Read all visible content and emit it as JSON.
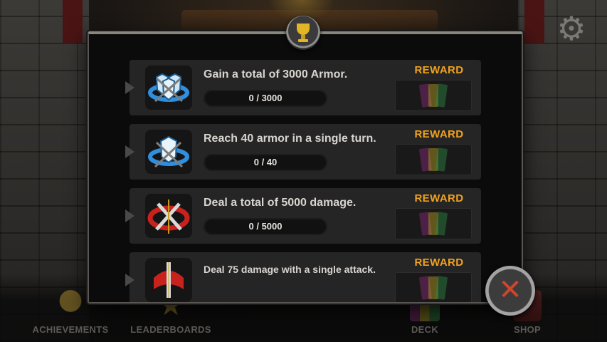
{
  "header": {
    "trophy_icon": "trophy-icon",
    "settings_icon": "gear-icon"
  },
  "achievements": [
    {
      "title": "Gain a total of 3000 Armor.",
      "progress_text": "0 / 3000",
      "progress_fraction": 0,
      "reward_label": "REWARD",
      "icon": "armor-shields-icon",
      "theme": "blue"
    },
    {
      "title": "Reach 40 armor in a single turn.",
      "progress_text": "0 / 40",
      "progress_fraction": 0,
      "reward_label": "REWARD",
      "icon": "armor-shield-icon",
      "theme": "blue"
    },
    {
      "title": "Deal a total of 5000 damage.",
      "progress_text": "0 / 5000",
      "progress_fraction": 0,
      "reward_label": "REWARD",
      "icon": "crossed-swords-icon",
      "theme": "red"
    },
    {
      "title": "Deal 75 damage with a single attack.",
      "reward_label": "REWARD",
      "icon": "sword-icon",
      "theme": "red"
    }
  ],
  "colors": {
    "reward_label": "#f0a21e",
    "close_x": "#d1452a",
    "blue_emblem": "#2f8fdf",
    "red_emblem": "#c8221d"
  },
  "nav": {
    "items": [
      {
        "label": "ACHIEVEMENTS",
        "icon": "trophy-icon"
      },
      {
        "label": "LEADERBOARDS",
        "icon": "star-icon"
      },
      {
        "label": "DECK",
        "icon": "cards-icon"
      },
      {
        "label": "SHOP",
        "icon": "shop-icon"
      }
    ]
  },
  "close_button": {
    "icon": "close-icon"
  }
}
